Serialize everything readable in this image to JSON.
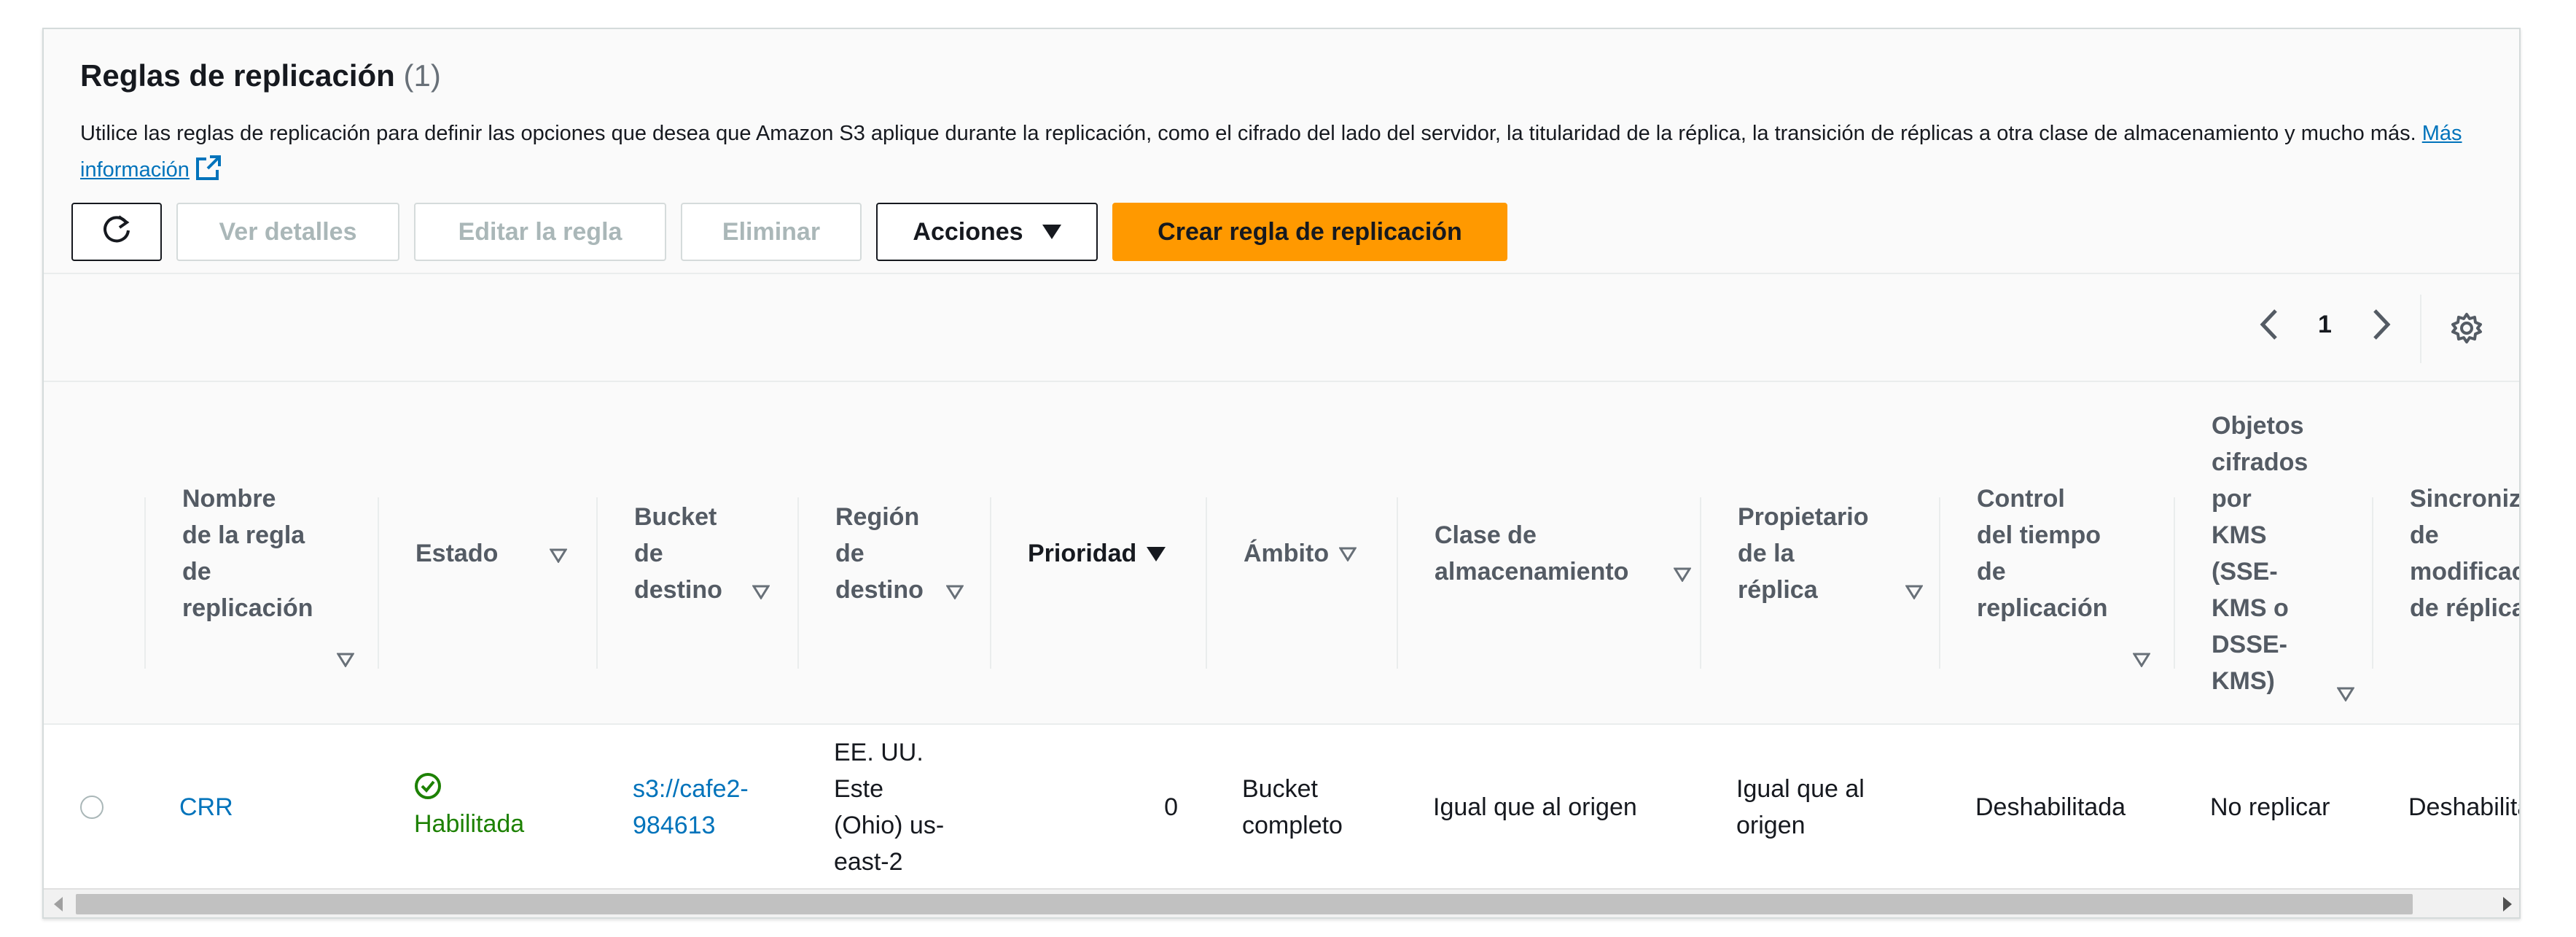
{
  "header": {
    "title": "Reglas de replicación",
    "count": "(1)",
    "description": "Utilice las reglas de replicación para definir las opciones que desea que Amazon S3 aplique durante la replicación, como el cifrado del lado del servidor, la titularidad de la réplica, la transición de réplicas a otra clase de almacenamiento y mucho más.",
    "learn_more": "Más información"
  },
  "toolbar": {
    "refresh_icon": "refresh-icon",
    "view_details": "Ver detalles",
    "edit_rule": "Editar la regla",
    "delete": "Eliminar",
    "actions": "Acciones",
    "create_rule": "Crear regla de replicación"
  },
  "pagination": {
    "current_page": "1",
    "prev_icon": "chevron-left-icon",
    "next_icon": "chevron-right-icon",
    "settings_icon": "gear-icon"
  },
  "table": {
    "columns": [
      {
        "label": "Nombre\nde la regla\nde\nreplicación",
        "sort": "unsorted"
      },
      {
        "label": "Estado",
        "sort": "unsorted"
      },
      {
        "label": "Bucket\nde\ndestino",
        "sort": "unsorted"
      },
      {
        "label": "Región\nde\ndestino",
        "sort": "unsorted"
      },
      {
        "label": "Prioridad",
        "sort": "sorted-descending"
      },
      {
        "label": "Ámbito",
        "sort": "unsorted"
      },
      {
        "label": "Clase de\nalmacenamiento",
        "sort": "unsorted"
      },
      {
        "label": "Propietario\nde la\nréplica",
        "sort": "unsorted"
      },
      {
        "label": "Control\ndel tiempo\nde\nreplicación",
        "sort": "unsorted"
      },
      {
        "label": "Objetos\ncifrados\npor\nKMS\n(SSE-\nKMS o\nDSSE-\nKMS)",
        "sort": "unsorted"
      },
      {
        "label": "Sincronización\nde\nmodificaciones\nde réplica",
        "sort": "unsorted"
      }
    ],
    "rows": [
      {
        "name": "CRR",
        "status": "Habilitada",
        "status_icon": "check-circle-icon",
        "bucket": "s3://cafe2-\n984613",
        "region": "EE. UU.\nEste\n(Ohio) us-\neast-2",
        "priority": "0",
        "scope": "Bucket\ncompleto",
        "storage_class": "Igual que al origen",
        "owner": "Igual que al\norigen",
        "rtc": "Deshabilitada",
        "kms": "No replicar",
        "sync": "Deshabilitada"
      }
    ]
  },
  "colors": {
    "primary": "#ff9900",
    "link": "#0073bb",
    "success": "#1d8102",
    "disabled": "#aab7b8"
  }
}
